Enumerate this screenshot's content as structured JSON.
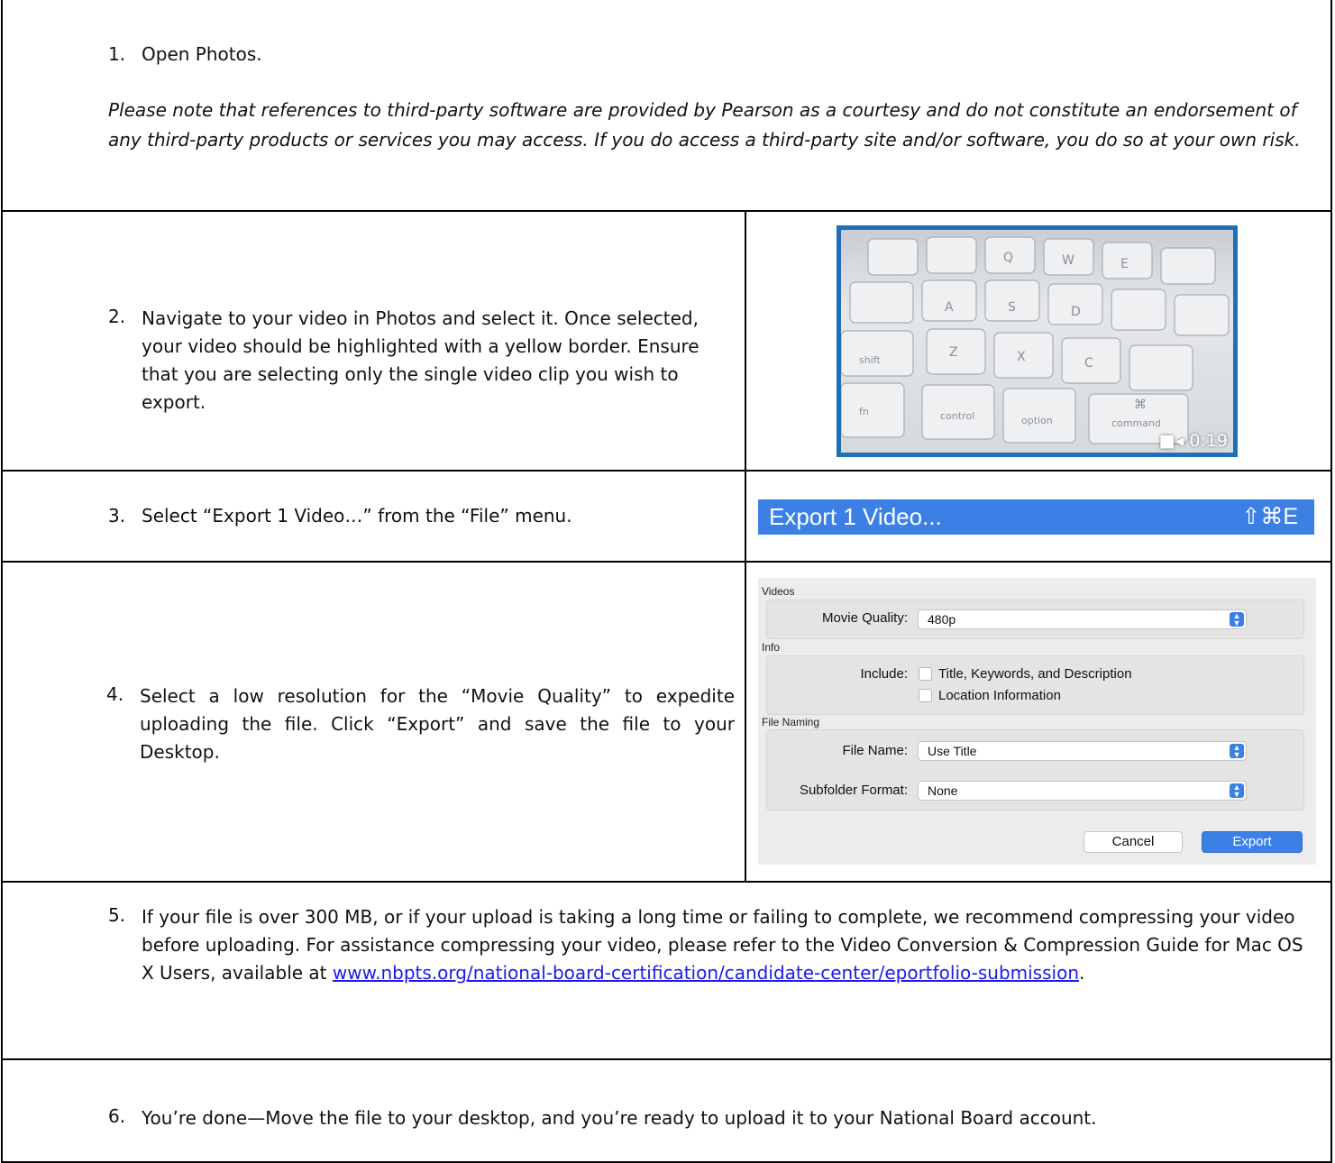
{
  "steps": [
    {
      "num": "1.",
      "text": "Open Photos.",
      "note": "Please note that references to third-party software are provided by Pearson as a courtesy and do not constitute an endorsement of any third-party products or services you may access. If you do access a third-party site and/or software, you do so at your own risk."
    },
    {
      "num": "2.",
      "text": "Navigate to your video in Photos and select it. Once selected, your video should be highlighted with a yellow border. Ensure that you are selecting only the single video clip you wish to export."
    },
    {
      "num": "3.",
      "text": "Select “Export 1 Video…” from the “File” menu."
    },
    {
      "num": "4.",
      "text": "Select a low resolution for the “Movie Quality” to expedite uploading the file. Click “Export” and save the file to your Desktop."
    },
    {
      "num": "5.",
      "text": "If your file is over 300 MB, or if your upload is taking a long time or failing to complete, we recommend compressing your video before uploading. For assistance compressing your video, please refer to the Video Conversion & Compression Guide for Mac OS X Users, available at",
      "link": "www.nbpts.org/national-board-certification/candidate-center/eportfolio-submission",
      "after_link": "."
    },
    {
      "num": "6.",
      "text": "You’re done—Move the file to your desktop, and you’re ready to upload it to your National Board account."
    }
  ],
  "photo": {
    "duration": "0:19",
    "key_labels": [
      "control",
      "option",
      "command",
      "shift",
      "fn",
      "Z",
      "X",
      "C",
      "A",
      "S",
      "D",
      "Q",
      "W",
      "E",
      "⌘"
    ]
  },
  "menu_item": {
    "label": "Export 1 Video...",
    "shortcut": "⇧⌘E",
    "color": "#3c80e6"
  },
  "dialog": {
    "sections": {
      "videos": "Videos",
      "info": "Info",
      "naming": "File Naming"
    },
    "movie_quality_label": "Movie Quality:",
    "movie_quality_value": "480p",
    "include_label": "Include:",
    "include_options": [
      "Title, Keywords, and Description",
      "Location Information"
    ],
    "file_name_label": "File Name:",
    "file_name_value": "Use Title",
    "subfolder_label": "Subfolder Format:",
    "subfolder_value": "None",
    "cancel": "Cancel",
    "export": "Export"
  }
}
